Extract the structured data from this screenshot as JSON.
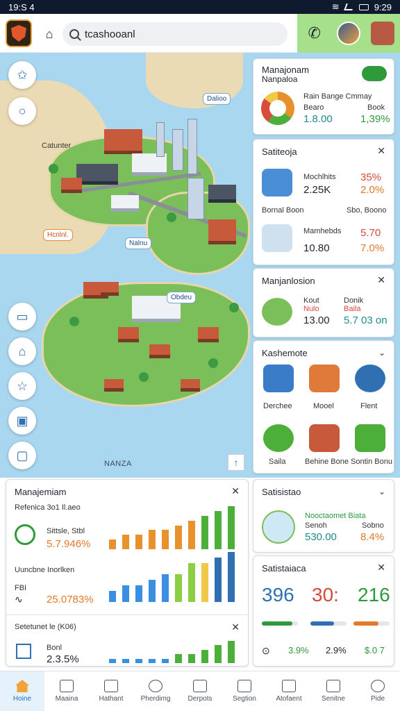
{
  "status_bar": {
    "time": "19:S 4",
    "clock": "9:29"
  },
  "header": {
    "search_value": "tcashooanl"
  },
  "map": {
    "labels": [
      "Catunter",
      "NANZA"
    ],
    "tags": [
      "Dalioo",
      "Hcnlnl.",
      "Nalnu",
      "Obdeu"
    ],
    "compass": "↑"
  },
  "card_top": {
    "title": "Manajonam",
    "subtitle": "Nanpaloa",
    "col1": "Rain Bange Cmmay",
    "col2_label": "Bearo",
    "col2_value": "1.8.00",
    "col3_label": "Book",
    "col3_value": "1,39%",
    "chart_data": {
      "type": "pie",
      "values": [
        0.35,
        0.25,
        0.25,
        0.15
      ],
      "colors": [
        "#e8902e",
        "#4caf3a",
        "#d94b3b",
        "#f1c94a"
      ]
    }
  },
  "card_satiteoja": {
    "title": "Satiteoja",
    "rows": [
      {
        "name": "Mochlhits",
        "value": "2.25K",
        "pct": "35%",
        "pct2": "2.0%"
      },
      {
        "name": "Mamhebds",
        "value": "10.80",
        "pct": "5.70",
        "pct2": "7.0%"
      }
    ],
    "mid_left": "Bornal Boon",
    "mid_right": "Sbo, Boono"
  },
  "card_manjanlosion": {
    "title": "Manjanlosion",
    "label1": "Kout",
    "label1b": "Nulo",
    "value1": "13.00",
    "label2": "Donik",
    "label2b": "Baila",
    "value2": "5.7 03 on"
  },
  "card_kashemote": {
    "title": "Kashemote",
    "items": [
      "Derchee",
      "Mooel",
      "Flent",
      "Saila",
      "Behine Bone",
      "Sontin Bonu"
    ]
  },
  "card_bottom_left": {
    "title": "Manajemiam",
    "subtitle": "Refenica 3o1 Il.aeo",
    "stat1_label": "Sittsle, Stbl",
    "stat1_value": "5.7.946%",
    "section2_title": "Uuncbne Inorlken",
    "stat2_label": "FBI",
    "stat2_value": "25.0783%",
    "section3_title": "Setetunet le (K06)",
    "stat3_label": "Bonl",
    "stat3_value": "2.3.5%",
    "chart_data": [
      {
        "type": "bar",
        "values": [
          2,
          3,
          3,
          4,
          4,
          5,
          6,
          7,
          8,
          9
        ],
        "colors": [
          "#e8922e",
          "#e8922e",
          "#e8922e",
          "#e8922e",
          "#e8922e",
          "#e8922e",
          "#e8922e",
          "#4caf3a",
          "#4caf3a",
          "#4caf3a"
        ]
      },
      {
        "type": "bar",
        "values": [
          2,
          3,
          3,
          4,
          5,
          5,
          7,
          7,
          8,
          9
        ],
        "colors": [
          "#3a8fe0",
          "#3a8fe0",
          "#3a8fe0",
          "#3a8fe0",
          "#3a8fe0",
          "#8ccf44",
          "#8ccf44",
          "#f1c94a",
          "#2f6fb2",
          "#2f6fb2"
        ]
      },
      {
        "type": "bar",
        "values": [
          1,
          1,
          1,
          1,
          1,
          2,
          2,
          3,
          4,
          5
        ],
        "colors": [
          "#3a8fe0",
          "#3a8fe0",
          "#3a8fe0",
          "#3a8fe0",
          "#3a8fe0",
          "#4caf3a",
          "#4caf3a",
          "#4caf3a",
          "#4caf3a",
          "#4caf3a"
        ]
      }
    ]
  },
  "card_satisistao": {
    "title": "Satisistao",
    "label_head": "Nooctaomet Biata",
    "left_label": "Senoh",
    "left_value": "530.00",
    "right_label": "Sobno",
    "right_value": "8.4%"
  },
  "card_satiscale": {
    "title": "Satistaiaca",
    "nums": [
      "396",
      "30:",
      "216"
    ],
    "progress": [
      0.85,
      0.65,
      0.7
    ],
    "bottom": [
      "3.9%",
      "2.9%",
      "$.0 7"
    ]
  },
  "bottom_nav": {
    "items": [
      "Hoine",
      "Maaina",
      "Hathant",
      "Pherdimg",
      "Derpots",
      "Segtion",
      "Atofaent",
      "Senitne",
      "Pide"
    ]
  }
}
